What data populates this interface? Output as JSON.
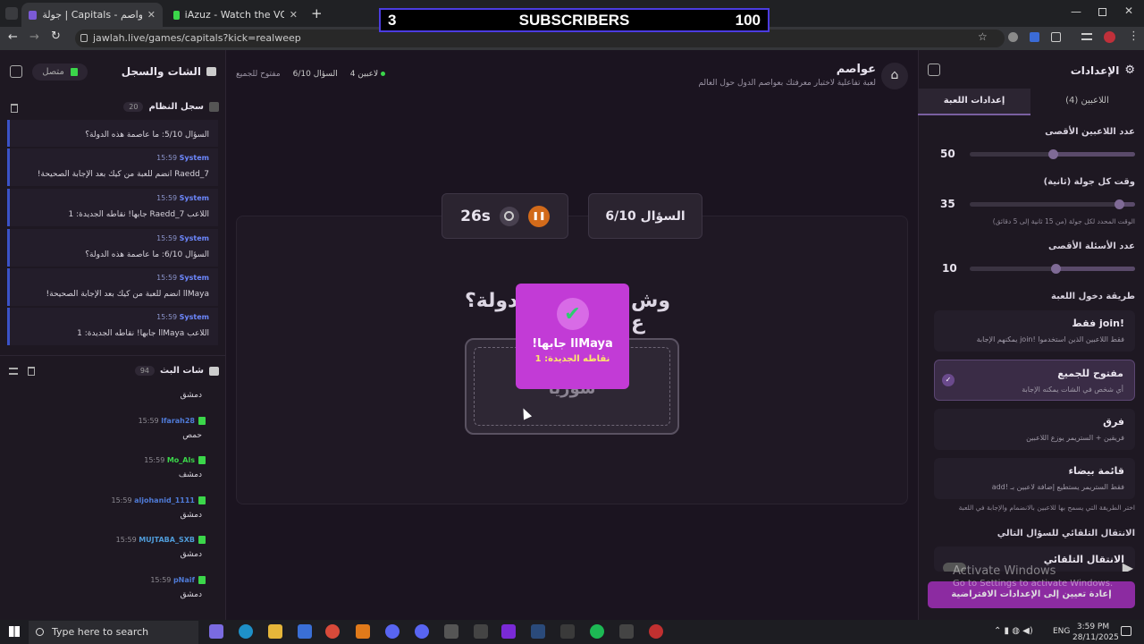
{
  "browser": {
    "tabs": [
      {
        "title": "جولة | Capitals - عواصم",
        "active": true
      },
      {
        "title": "iAzuz - Watch the VOD on Kick",
        "active": false
      }
    ],
    "url": "jawlah.live/games/capitals?kick=realweep"
  },
  "overlay": {
    "left": "3",
    "center": "SUBSCRIBERS",
    "right": "100"
  },
  "left_panel": {
    "title": "الشات والسجل",
    "status": "متصل",
    "system_log": {
      "title": "سجل النظام",
      "count": "20"
    },
    "system_messages": [
      {
        "time": "",
        "sender": "",
        "text": "السؤال 5/10: ما عاصمة هذه الدولة؟"
      },
      {
        "time": "15:59",
        "sender": "System",
        "text": "Raedd_7 انضم للعبة من كيك بعد الإجابة الصحيحة!"
      },
      {
        "time": "15:59",
        "sender": "System",
        "text": "اللاعب Raedd_7 جابها! نقاطه الجديدة: 1"
      },
      {
        "time": "15:59",
        "sender": "System",
        "text": "السؤال 6/10: ما عاصمة هذه الدولة؟"
      },
      {
        "time": "15:59",
        "sender": "System",
        "text": "llMaya انضم للعبة من كيك بعد الإجابة الصحيحة!"
      },
      {
        "time": "15:59",
        "sender": "System",
        "text": "اللاعب llMaya جابها! نقاطه الجديدة: 1"
      }
    ],
    "live_chat": {
      "title": "شات البث",
      "count": "94"
    },
    "chat_messages": [
      {
        "time": "",
        "user": "",
        "color": "#4f7bd8",
        "text": "دمشق"
      },
      {
        "time": "15:59",
        "user": "lfarah28",
        "color": "#4f7bd8",
        "text": "حمص"
      },
      {
        "time": "15:59",
        "user": "Mo_Als",
        "color": "#3bd64a",
        "text": "دمشف"
      },
      {
        "time": "15:59",
        "user": "aljohanid_1111",
        "color": "#4f7bd8",
        "text": "دمشق"
      },
      {
        "time": "15:59",
        "user": "MUJTABA_SXB",
        "color": "#4f9bd8",
        "text": "دمشق"
      },
      {
        "time": "15:59",
        "user": "pNaif",
        "color": "#4f7bd8",
        "text": "دمشق"
      }
    ]
  },
  "center": {
    "game_title": "عواصم",
    "game_subtitle": "لعبة تفاعلية لاختبار معرفتك بعواصم الدول حول العالم",
    "players": "4 لاعبين",
    "question_indicator": "السؤال 6/10",
    "mode": "مفتوح للجميع",
    "timer": "26s",
    "question_card": "السؤال 6/10",
    "question_text_left": "وش ع",
    "question_text_right": "دولة؟",
    "answer": "سوريا",
    "popup": {
      "title": "llMaya جابها!",
      "subtitle": "نقاطه الجديدة: 1"
    }
  },
  "right_panel": {
    "title": "الإعدادات",
    "tabs": [
      "اللاعبين (4)",
      "إعدادات اللعبة"
    ],
    "max_players": {
      "label": "عدد اللاعبين الأقصى",
      "value": "50",
      "level": 0.5
    },
    "round_time": {
      "label": "وقت كل جولة (ثانية)",
      "value": "35",
      "hint": "الوقت المحدد لكل جولة (من 15 ثانية إلى 5 دقائق)",
      "level": 0.1
    },
    "max_questions": {
      "label": "عدد الأسئلة الأقصى",
      "value": "10",
      "level": 0.48
    },
    "join_method_label": "طريقة دخول اللعبة",
    "options": [
      {
        "title": "!join فقط",
        "desc": "فقط اللاعبين الذين استخدموا !join يمكنهم الإجابة",
        "selected": false
      },
      {
        "title": "مفتوح للجميع",
        "desc": "أي شخص في الشات يمكنه الإجابة",
        "selected": true
      },
      {
        "title": "فرق",
        "desc": "فريقين + الستريمر يوزع اللاعبين",
        "selected": false
      },
      {
        "title": "قائمة بيضاء",
        "desc": "فقط الستريمر يستطيع إضافة لاعبين بـ !add",
        "selected": false
      }
    ],
    "join_hint": "اختر الطريقة التي يسمح بها للاعبين بالانضمام والإجابة في اللعبة",
    "auto_next_label": "الانتقال التلقائي للسؤال التالي",
    "auto_next_option": "الانتقال التلقائي",
    "reset_button": "إعادة تعيين إلى الإعدادات الافتراضية",
    "watermark_title": "Activate Windows",
    "watermark_sub": "Go to Settings to activate Windows."
  },
  "taskbar": {
    "search_placeholder": "Type here to search",
    "lang": "ENG",
    "time": "3:59 PM",
    "date": "28/11/2025"
  }
}
